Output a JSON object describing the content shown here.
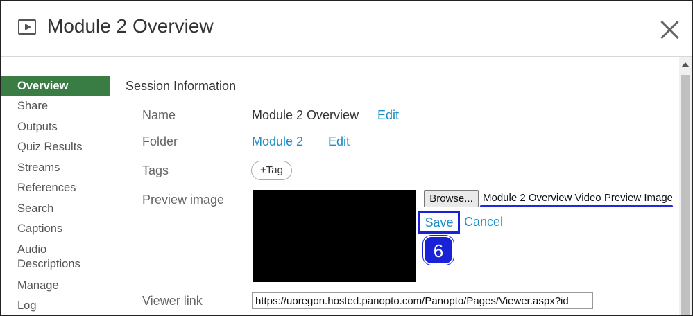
{
  "header": {
    "title": "Module 2 Overview",
    "icon": "play-icon",
    "close_icon": "close-icon"
  },
  "sidebar": {
    "items": [
      {
        "label": "Overview",
        "active": true
      },
      {
        "label": "Share"
      },
      {
        "label": "Outputs"
      },
      {
        "label": "Quiz Results"
      },
      {
        "label": "Streams"
      },
      {
        "label": "References"
      },
      {
        "label": "Search"
      },
      {
        "label": "Captions"
      },
      {
        "label": "Audio Descriptions"
      },
      {
        "label": "Manage"
      },
      {
        "label": "Log"
      }
    ]
  },
  "main": {
    "section_title": "Session Information",
    "name": {
      "label": "Name",
      "value": "Module 2 Overview",
      "edit": "Edit"
    },
    "folder": {
      "label": "Folder",
      "value": "Module 2",
      "edit": "Edit"
    },
    "tags": {
      "label": "Tags",
      "button": "+Tag"
    },
    "preview": {
      "label": "Preview image",
      "browse": "Browse...",
      "file_name": "Module 2 Overview Video Preview Image",
      "save": "Save",
      "cancel": "Cancel",
      "step": "6"
    },
    "viewer_link": {
      "label": "Viewer link",
      "value": "https://uoregon.hosted.panopto.com/Panopto/Pages/Viewer.aspx?id"
    }
  },
  "colors": {
    "accent_green": "#3a7d44",
    "link_blue": "#1a8ec6",
    "highlight_blue": "#1a22d8"
  }
}
